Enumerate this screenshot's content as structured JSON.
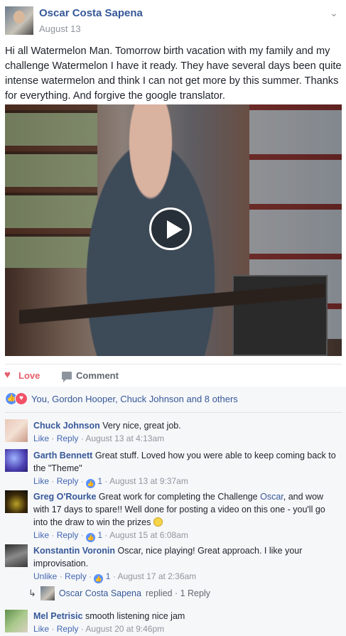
{
  "post": {
    "author": "Oscar Costa Sapena",
    "date": "August 13",
    "text": "Hi all Watermelon Man. Tomorrow birth vacation with my family and my challenge Watermelon I have it ready. They have several days been quite intense watermelon and think I can not get more by this summer. Thanks for everything. And forgive the google translator."
  },
  "actions": {
    "love": "Love",
    "comment": "Comment"
  },
  "reactions": {
    "summary": "You, Gordon Hooper, Chuck Johnson and 8 others"
  },
  "comments": [
    {
      "name": "Chuck Johnson",
      "text": "Very nice, great job.",
      "like": "Like",
      "reply": "Reply",
      "time": "August 13 at 4:13am"
    },
    {
      "name": "Garth Bennett",
      "text": "Great stuff. Loved how you were able to keep coming back to the \"Theme\"",
      "like": "Like",
      "reply": "Reply",
      "likes": "1",
      "time": "August 13 at 9:37am"
    },
    {
      "name": "Greg O'Rourke",
      "text_a": "Great work for completing the Challenge ",
      "mention": "Oscar",
      "text_b": ", and wow with 17 days to spare!! Well done for posting a video on this one - you'll go into the draw to win the prizes ",
      "like": "Like",
      "reply": "Reply",
      "likes": "1",
      "time": "August 15 at 6:08am"
    },
    {
      "name": "Konstantin Voronin",
      "text": "Oscar, nice playing! Great approach. I like your improvisation.",
      "like": "Unlike",
      "reply": "Reply",
      "likes": "1",
      "time": "August 17 at 2:36am",
      "replies": {
        "name": "Oscar Costa Sapena",
        "label": "replied · 1 Reply"
      }
    },
    {
      "name": "Mel Petrisic",
      "text": "smooth listening nice jam",
      "like": "Like",
      "reply": "Reply",
      "time": "August 20 at 9:46pm"
    }
  ],
  "colors": {
    "link": "#365899",
    "love": "#e75e6b",
    "meta": "#90949c",
    "like_badge": "#5890ff"
  },
  "icons": {
    "menu": "chevron-down-icon",
    "play": "play-icon",
    "love": "heart-icon",
    "comment": "comment-bubble-icon"
  }
}
